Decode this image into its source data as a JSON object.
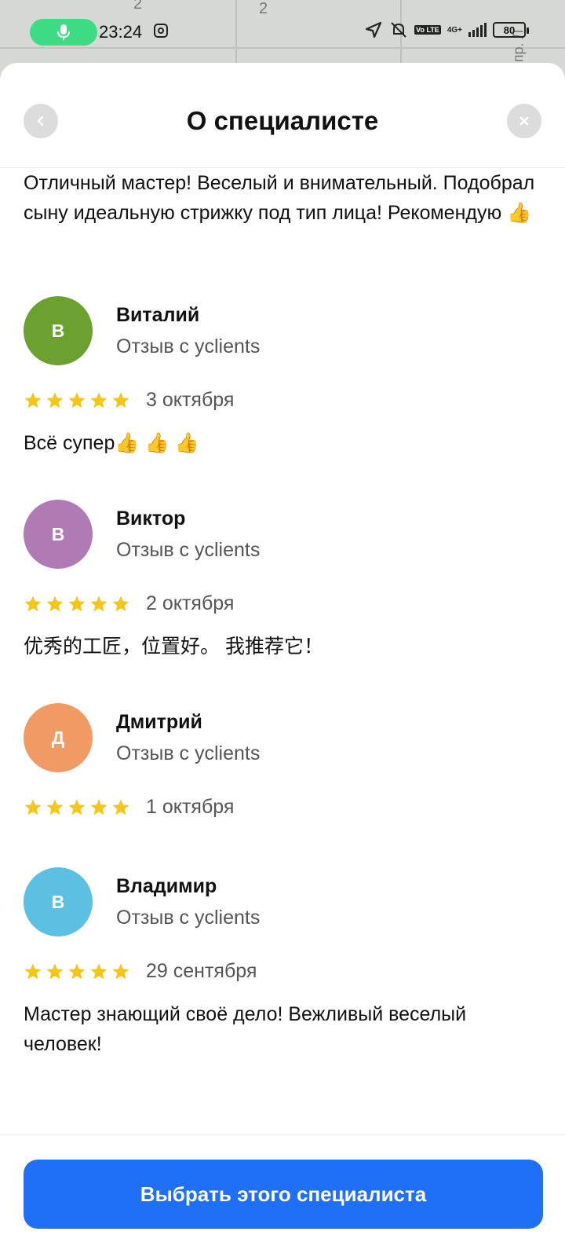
{
  "status_bar": {
    "time": "23:24",
    "battery": "80",
    "network": "4G+",
    "lte": "Vo LTE"
  },
  "map_background": {
    "label_1": "2",
    "label_2": "2",
    "street": "пр. Л"
  },
  "header": {
    "title": "О специалисте",
    "back_icon": "chevron-left-icon",
    "close_icon": "close-icon"
  },
  "intro_review_text": "Отличный мастер! Веселый и внимательный. Подобрал сыну идеальную стрижку под тип лица! Рекомендую 👍",
  "reviews": [
    {
      "initial": "В",
      "name": "Виталий",
      "source": "Отзыв с yclients",
      "rating": 5,
      "date": "3 октября",
      "text": "Всё супер👍 👍 👍",
      "avatar_color": "#6aa12f"
    },
    {
      "initial": "В",
      "name": "Виктор",
      "source": "Отзыв с yclients",
      "rating": 5,
      "date": "2 октября",
      "text": "优秀的工匠，位置好。 我推荐它！",
      "avatar_color": "#b07ab5"
    },
    {
      "initial": "Д",
      "name": "Дмитрий",
      "source": "Отзыв с yclients",
      "rating": 5,
      "date": "1 октября",
      "text": "",
      "avatar_color": "#f09a64"
    },
    {
      "initial": "В",
      "name": "Владимир",
      "source": "Отзыв с yclients",
      "rating": 5,
      "date": "29 сентября",
      "text": "Мастер знающий своё дело! Вежливый веселый человек!",
      "avatar_color": "#5bc0e2"
    }
  ],
  "cta": {
    "label": "Выбрать этого специалиста",
    "color": "#1f6ff7"
  },
  "colors": {
    "star": "#f5c518"
  }
}
